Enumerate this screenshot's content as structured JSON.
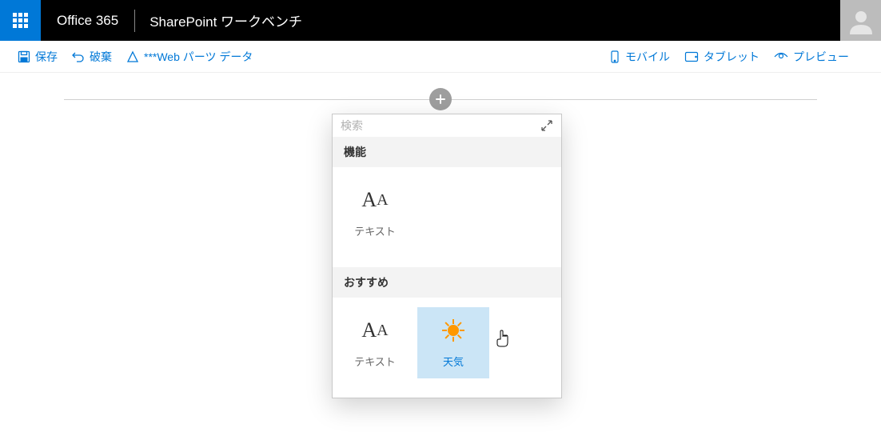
{
  "topbar": {
    "brand": "Office 365",
    "title": "SharePoint ワークベンチ"
  },
  "cmdbar": {
    "save": "保存",
    "discard": "破棄",
    "webpartData": "***Web パーツ データ",
    "mobile": "モバイル",
    "tablet": "タブレット",
    "preview": "プレビュー"
  },
  "picker": {
    "search_placeholder": "検索",
    "sections": {
      "features": "機能",
      "recommended": "おすすめ"
    },
    "items": {
      "text": "テキスト",
      "weather": "天気"
    }
  }
}
